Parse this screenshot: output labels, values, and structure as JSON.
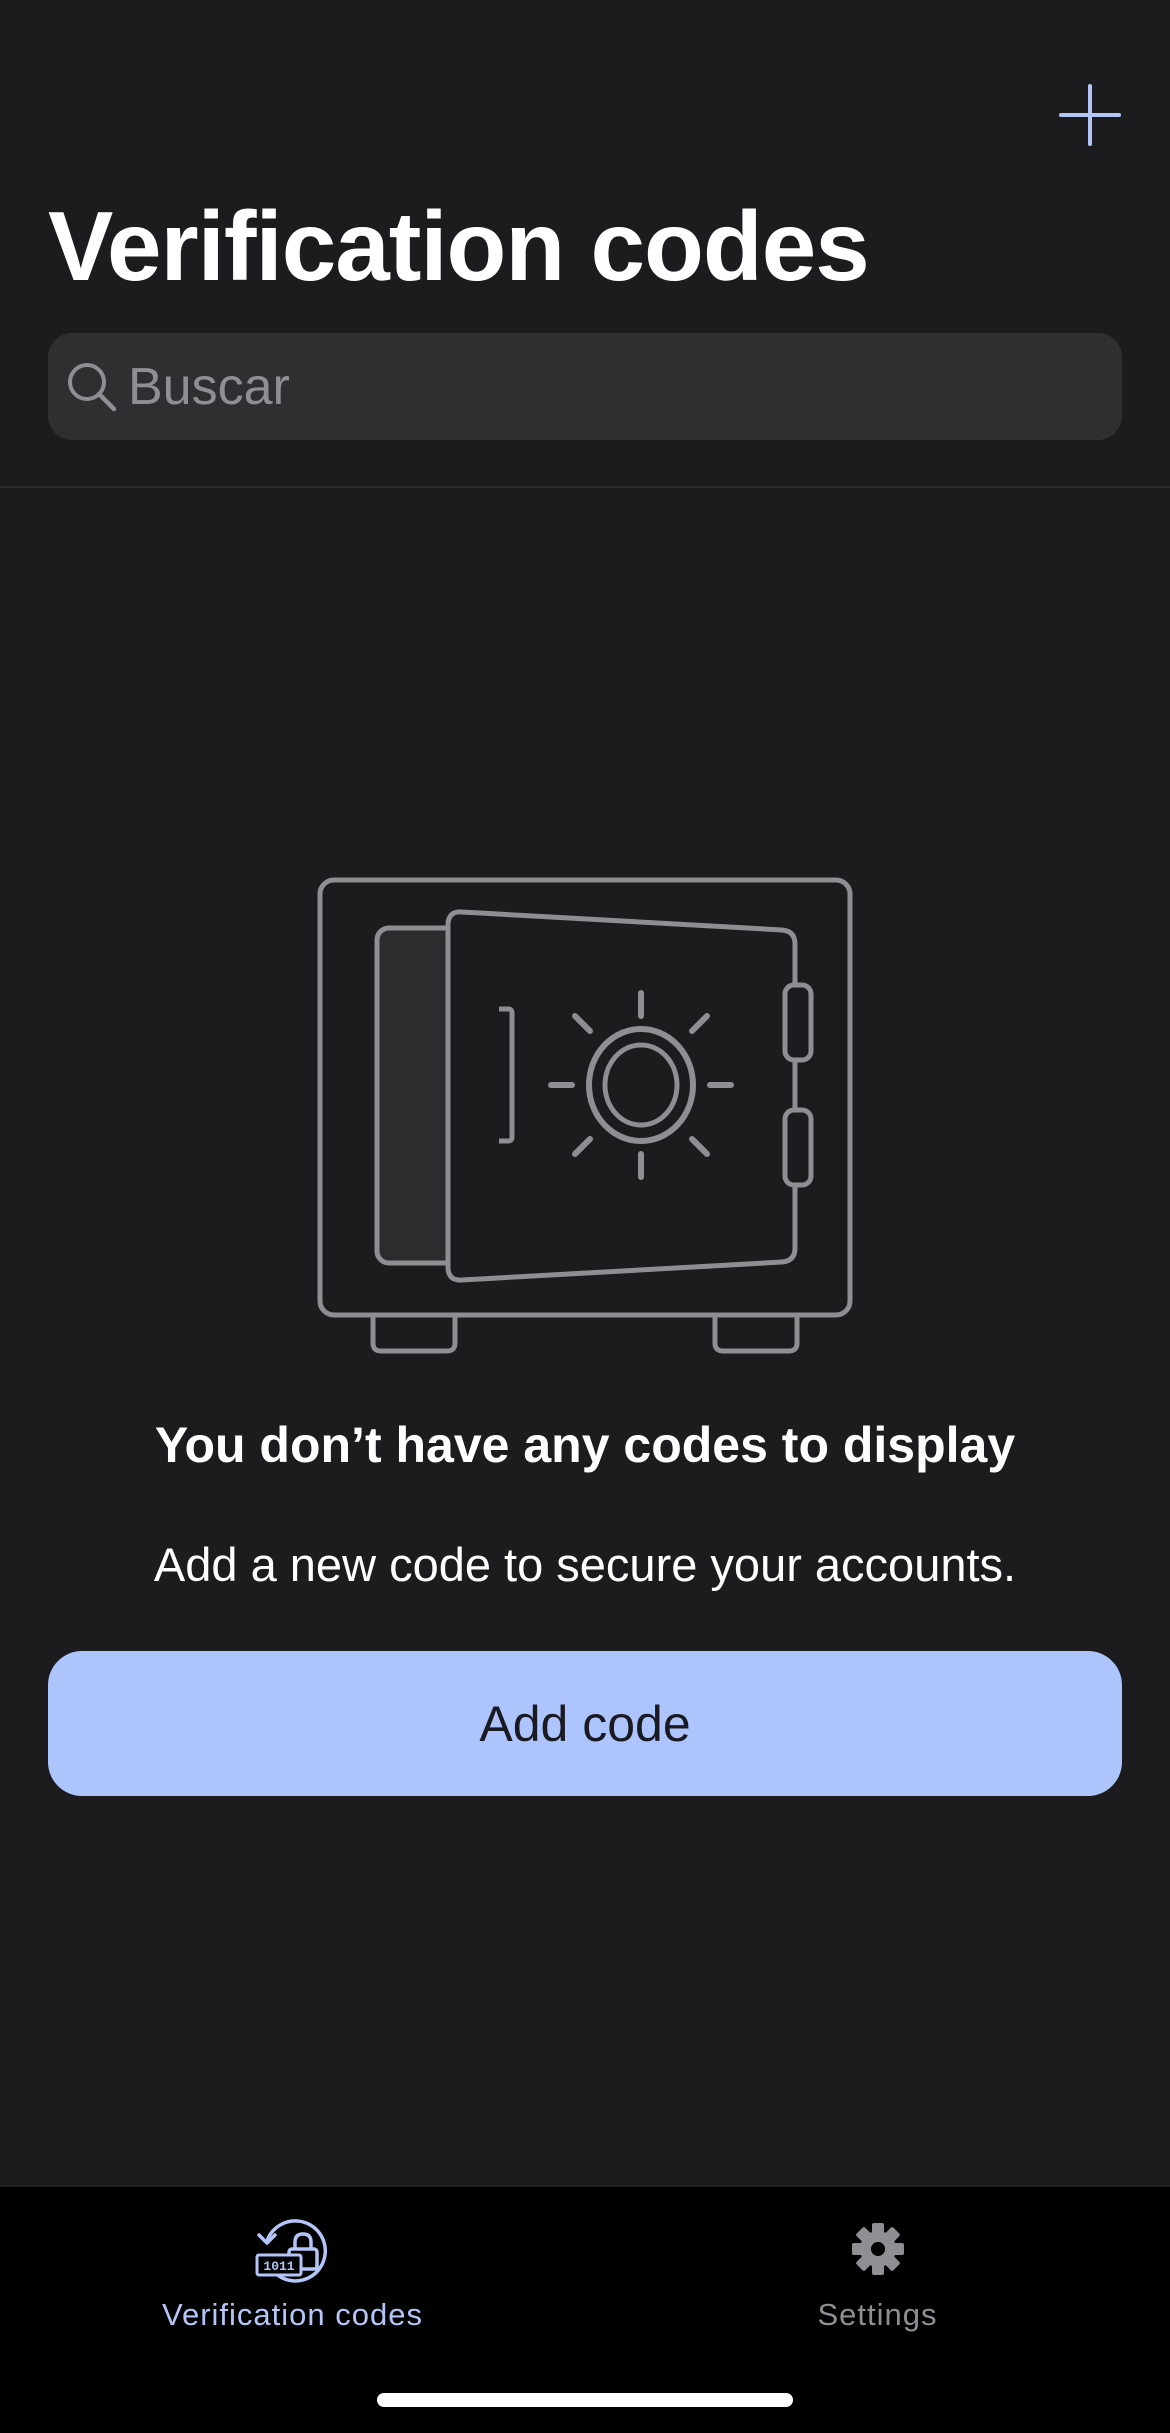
{
  "header": {
    "title": "Verification codes",
    "add_icon": "plus-icon"
  },
  "search": {
    "placeholder": "Buscar",
    "value": "",
    "icon": "search-icon"
  },
  "empty_state": {
    "illustration": "safe-illustration",
    "title": "You don’t have any codes to display",
    "subtitle": "Add a new code to secure your accounts.",
    "button_label": "Add code"
  },
  "tab_bar": {
    "tabs": [
      {
        "label": "Verification codes",
        "icon": "verification-codes-icon",
        "selected": true
      },
      {
        "label": "Settings",
        "icon": "gear-icon",
        "selected": false
      }
    ]
  },
  "colors": {
    "background": "#1c1c1e",
    "accent": "#aec4fd",
    "tab_active": "#b4c6f7",
    "tab_inactive": "#8e8e93",
    "search_background": "#2f2f32"
  }
}
